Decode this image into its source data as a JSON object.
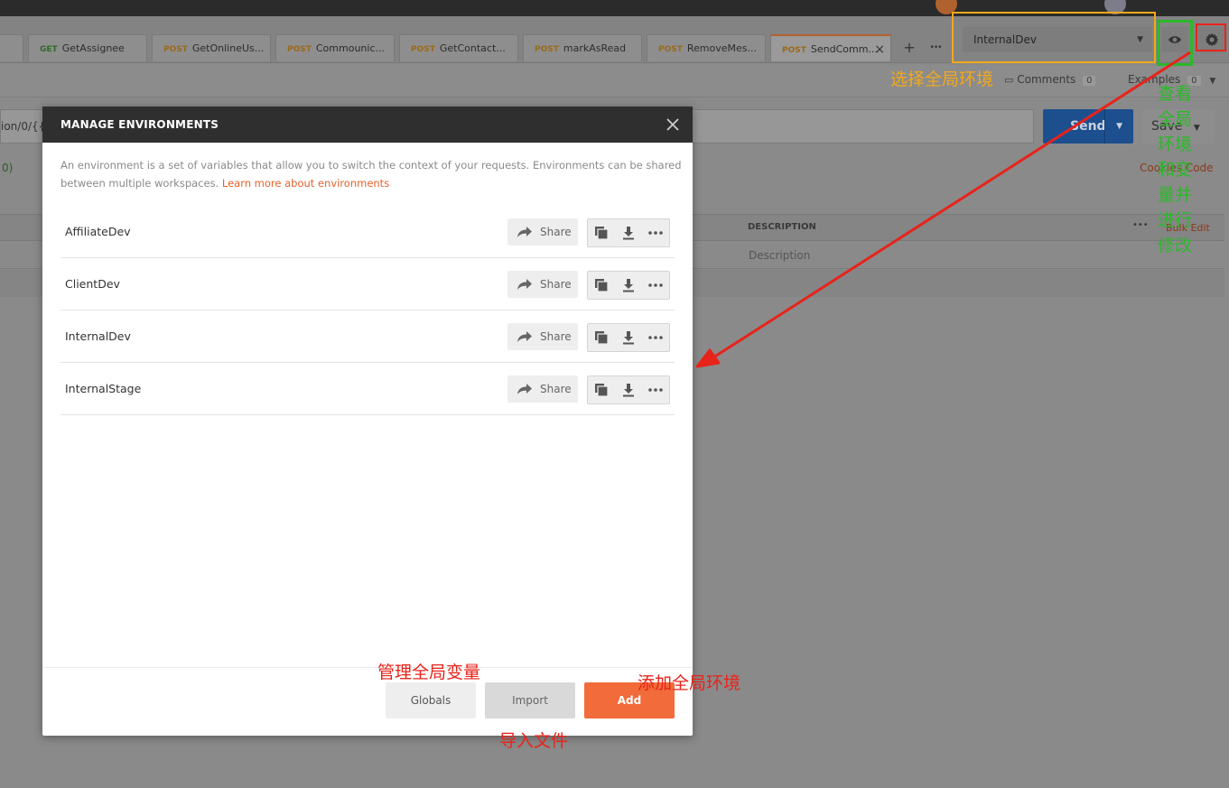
{
  "tabs": [
    {
      "method": "",
      "label": "",
      "active": false
    },
    {
      "method": "GET",
      "label": "GetAssignee",
      "active": false
    },
    {
      "method": "POST",
      "label": "GetOnlineUs...",
      "active": false
    },
    {
      "method": "POST",
      "label": "Commounic...",
      "active": false
    },
    {
      "method": "POST",
      "label": "GetContact...",
      "active": false
    },
    {
      "method": "POST",
      "label": "markAsRead",
      "active": false
    },
    {
      "method": "POST",
      "label": "RemoveMes...",
      "active": false
    },
    {
      "method": "POST",
      "label": "SendComm...",
      "active": true
    }
  ],
  "tab_controls": {
    "close": "×",
    "add": "+",
    "more": "•••"
  },
  "environment": {
    "selected": "InternalDev"
  },
  "request": {
    "comments_label": "Comments",
    "comments_count": "0",
    "examples_label": "Examples",
    "examples_count": "0",
    "url_fragment": "ion/0/{{t",
    "send_label": "Send",
    "save_label": "Save",
    "params_fragment": "0)",
    "cookies_label": "Cookies",
    "code_label": "Code",
    "description_header": "DESCRIPTION",
    "bulk_edit_label": "Bulk Edit",
    "description_placeholder": "Description"
  },
  "modal": {
    "title": "MANAGE ENVIRONMENTS",
    "description": "An environment is a set of variables that allow you to switch the context of your requests. Environments can be shared between multiple workspaces.",
    "learn_more": "Learn more about environments",
    "share_label": "Share",
    "environments": [
      {
        "name": "AffiliateDev"
      },
      {
        "name": "ClientDev"
      },
      {
        "name": "InternalDev"
      },
      {
        "name": "InternalStage"
      }
    ],
    "footer": {
      "globals": "Globals",
      "import": "Import",
      "add": "Add"
    }
  },
  "annotations": {
    "select_env": "选择全局环境",
    "view_env": "查看全局环境和变量并进行修改",
    "manage_globals": "管理全局变量",
    "add_env": "添加全局环境",
    "import_file": "导入文件",
    "colors": {
      "orange": "#f2a81c",
      "green": "#2cb82a",
      "red": "#e8231a"
    }
  },
  "colors": {
    "accent": "#f26b3a",
    "send": "#1d4f8f",
    "modal_header": "#2f2f2f"
  }
}
